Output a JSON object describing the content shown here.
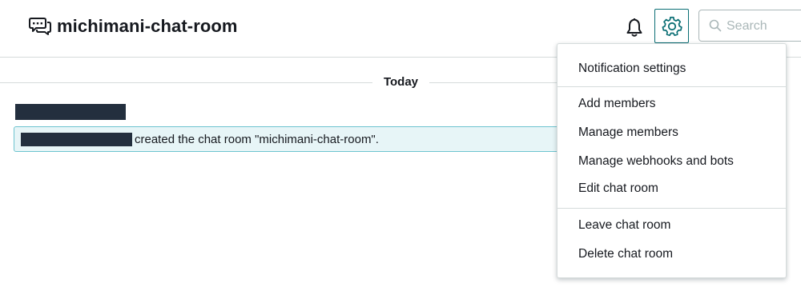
{
  "header": {
    "room_icon": "chat-bubbles-icon",
    "room_title": "michimani-chat-room",
    "bell_icon": "bell-icon",
    "gear_icon": "gear-icon",
    "search": {
      "icon": "search-icon",
      "placeholder": "Search",
      "value": ""
    }
  },
  "timeline": {
    "day_label": "Today",
    "messages": [
      {
        "sender": "[redacted]",
        "user": "[redacted]",
        "text": "created the chat room \"michimani-chat-room\"."
      }
    ]
  },
  "settings_menu": {
    "groups": [
      [
        "Notification settings"
      ],
      [
        "Add members",
        "Manage members",
        "Manage webhooks and bots",
        "Edit chat room"
      ],
      [
        "Leave chat room",
        "Delete chat room"
      ]
    ]
  },
  "colors": {
    "accent": "#0a6e74",
    "system_message_bg": "#e7f5f7",
    "system_message_border": "#6ec4cf",
    "redaction": "#232f3e",
    "divider": "#d5dbdb"
  }
}
